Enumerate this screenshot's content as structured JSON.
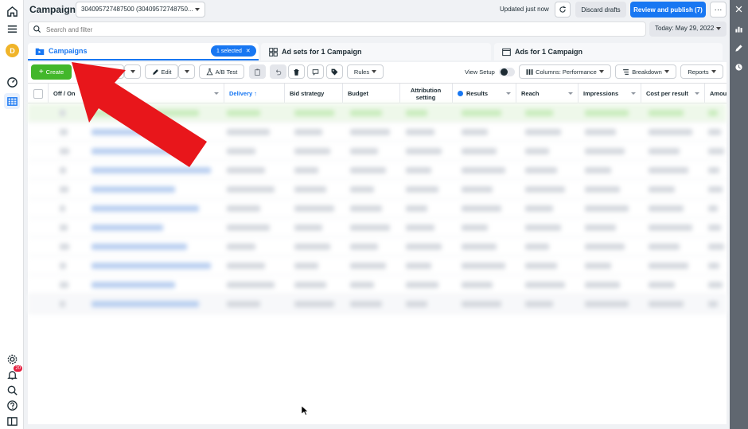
{
  "header": {
    "title": "Campaigns",
    "account": "304095727487500 (30409572748750...",
    "updated": "Updated just now",
    "discard": "Discard drafts",
    "publish": "Review and publish (7)",
    "more": "···"
  },
  "search": {
    "placeholder": "Search and filter"
  },
  "date": {
    "label": "Today: May 29, 2022"
  },
  "user": {
    "initial": "D"
  },
  "notifications": {
    "count": "20"
  },
  "tabs": [
    {
      "label": "Campaigns",
      "selected": "1 selected"
    },
    {
      "label": "Ad sets for 1 Campaign"
    },
    {
      "label": "Ads for 1 Campaign"
    }
  ],
  "toolbar": {
    "create": "Create",
    "duplicate": "Duplicate",
    "edit": "Edit",
    "ab_test": "A/B Test",
    "rules": "Rules",
    "view_setup": "View Setup",
    "columns": "Columns: Performance",
    "breakdown": "Breakdown",
    "reports": "Reports"
  },
  "table": {
    "columns": [
      "Off / On",
      "Delivery ↑",
      "Bid strategy",
      "Budget",
      "Attribution setting",
      "Results",
      "Reach",
      "Impressions",
      "Cost per result",
      "Amou"
    ]
  },
  "colors": {
    "accent": "#1877f2",
    "create": "#42b72a",
    "arrow": "#e8161b"
  }
}
